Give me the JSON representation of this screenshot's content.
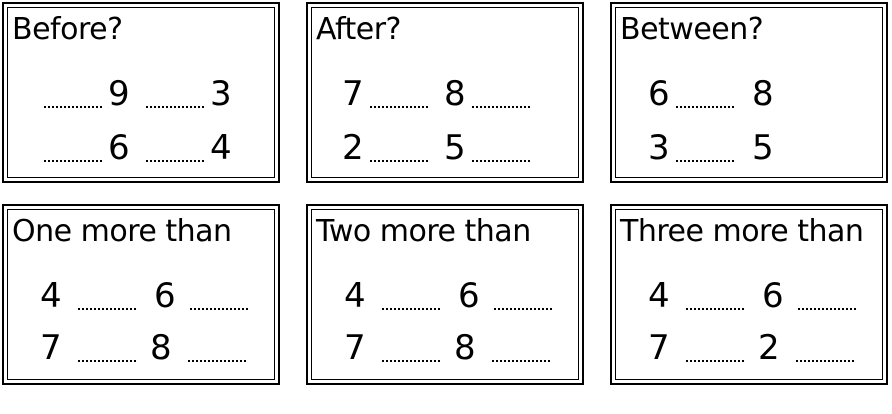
{
  "cards": [
    {
      "title": "Before?",
      "rows": [
        [
          "9",
          "3"
        ],
        [
          "6",
          "4"
        ]
      ]
    },
    {
      "title": "After?",
      "rows": [
        [
          "7",
          "8"
        ],
        [
          "2",
          "5"
        ]
      ]
    },
    {
      "title": "Between?",
      "rows": [
        [
          "6",
          "8"
        ],
        [
          "3",
          "5"
        ]
      ]
    },
    {
      "title": "One more than",
      "rows": [
        [
          "4",
          "6"
        ],
        [
          "7",
          "8"
        ]
      ]
    },
    {
      "title": "Two more than",
      "rows": [
        [
          "4",
          "6"
        ],
        [
          "7",
          "8"
        ]
      ]
    },
    {
      "title": "Three more than",
      "rows": [
        [
          "4",
          "6"
        ],
        [
          "7",
          "2"
        ]
      ]
    }
  ]
}
